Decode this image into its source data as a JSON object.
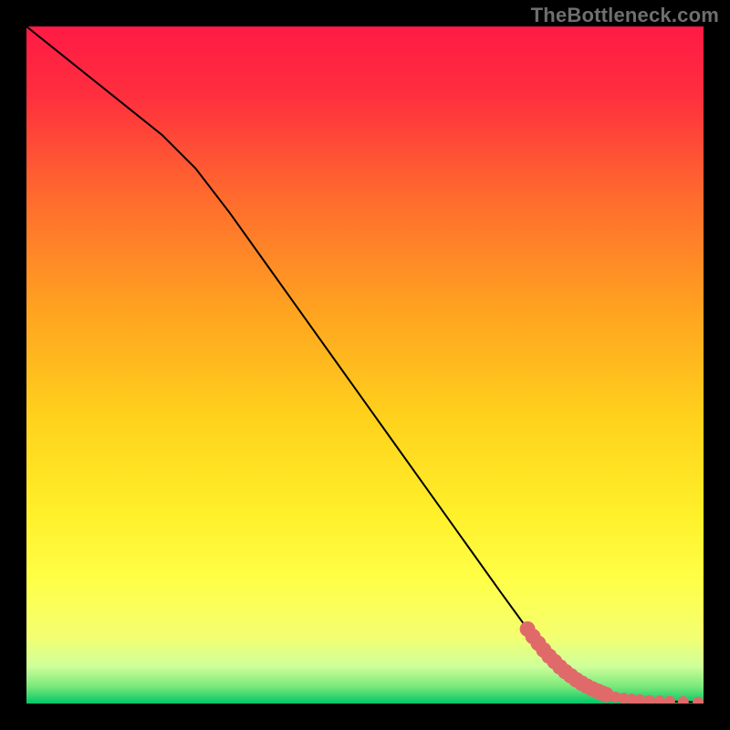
{
  "watermark": "TheBottleneck.com",
  "chart_data": {
    "type": "line",
    "title": "",
    "xlabel": "",
    "ylabel": "",
    "xlim": [
      0,
      100
    ],
    "ylim": [
      0,
      100
    ],
    "grid": false,
    "legend": false,
    "background": {
      "style": "vertical-gradient",
      "stops": [
        {
          "pos": 0.0,
          "color": "#ff1a45"
        },
        {
          "pos": 0.1,
          "color": "#ff2e3e"
        },
        {
          "pos": 0.25,
          "color": "#ff6a2e"
        },
        {
          "pos": 0.42,
          "color": "#ffa320"
        },
        {
          "pos": 0.58,
          "color": "#ffd21c"
        },
        {
          "pos": 0.72,
          "color": "#fff02a"
        },
        {
          "pos": 0.82,
          "color": "#ffff48"
        },
        {
          "pos": 0.9,
          "color": "#f4ff70"
        },
        {
          "pos": 0.945,
          "color": "#cfff9a"
        },
        {
          "pos": 0.975,
          "color": "#7ae87a"
        },
        {
          "pos": 1.0,
          "color": "#00c768"
        }
      ]
    },
    "series": [
      {
        "name": "bottleneck-curve",
        "color": "#000000",
        "stroke_width": 2,
        "x": [
          0,
          5,
          10,
          15,
          20,
          25,
          30,
          35,
          40,
          45,
          50,
          55,
          60,
          65,
          70,
          74,
          77,
          80,
          82,
          84,
          85.5,
          87,
          90,
          93,
          96,
          99,
          100
        ],
        "y": [
          100,
          96,
          92,
          88,
          84,
          79,
          72.5,
          65.5,
          58.5,
          51.5,
          44.5,
          37.5,
          30.5,
          23.5,
          16.5,
          11,
          7.5,
          4.8,
          3.0,
          1.8,
          1.2,
          0.9,
          0.55,
          0.38,
          0.28,
          0.2,
          0.18
        ]
      }
    ],
    "bead_overlay": {
      "name": "scatter-beads",
      "color": "#e06a6a",
      "radius_large": 8.5,
      "radius_small": 6.0,
      "points": [
        {
          "x": 74.0,
          "y": 11.0,
          "r": "large"
        },
        {
          "x": 74.8,
          "y": 9.9,
          "r": "large"
        },
        {
          "x": 75.6,
          "y": 8.9,
          "r": "large"
        },
        {
          "x": 76.4,
          "y": 7.9,
          "r": "large"
        },
        {
          "x": 77.2,
          "y": 7.0,
          "r": "large"
        },
        {
          "x": 78.0,
          "y": 6.2,
          "r": "large"
        },
        {
          "x": 78.8,
          "y": 5.4,
          "r": "large"
        },
        {
          "x": 79.6,
          "y": 4.7,
          "r": "large"
        },
        {
          "x": 80.4,
          "y": 4.1,
          "r": "large"
        },
        {
          "x": 81.2,
          "y": 3.5,
          "r": "large"
        },
        {
          "x": 82.0,
          "y": 3.0,
          "r": "large"
        },
        {
          "x": 82.8,
          "y": 2.55,
          "r": "large"
        },
        {
          "x": 83.6,
          "y": 2.15,
          "r": "large"
        },
        {
          "x": 84.4,
          "y": 1.8,
          "r": "large"
        },
        {
          "x": 85.0,
          "y": 1.55,
          "r": "large"
        },
        {
          "x": 85.6,
          "y": 1.32,
          "r": "large"
        },
        {
          "x": 86.0,
          "y": 1.18,
          "r": "small"
        },
        {
          "x": 87.0,
          "y": 0.95,
          "r": "small"
        },
        {
          "x": 88.2,
          "y": 0.78,
          "r": "small"
        },
        {
          "x": 89.4,
          "y": 0.65,
          "r": "small"
        },
        {
          "x": 90.6,
          "y": 0.55,
          "r": "small"
        },
        {
          "x": 92.0,
          "y": 0.46,
          "r": "small"
        },
        {
          "x": 93.5,
          "y": 0.39,
          "r": "small"
        },
        {
          "x": 95.0,
          "y": 0.33,
          "r": "small"
        },
        {
          "x": 97.0,
          "y": 0.27,
          "r": "small"
        },
        {
          "x": 99.2,
          "y": 0.2,
          "r": "small"
        }
      ]
    }
  }
}
